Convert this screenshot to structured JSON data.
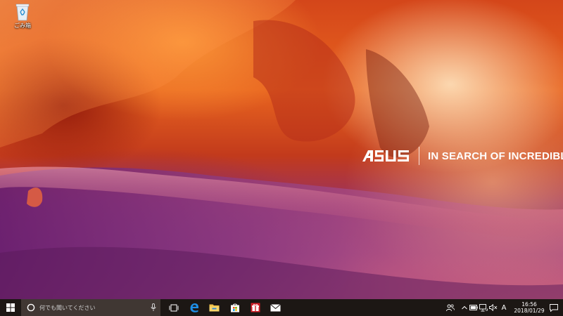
{
  "desktop": {
    "recycle_bin_label": "ごみ箱",
    "brand": "ASUS",
    "slogan": "IN SEARCH OF INCREDIBLE"
  },
  "taskbar": {
    "search_placeholder": "何でも聞いてください",
    "pinned": [
      "task-view-icon",
      "edge-icon",
      "file-explorer-icon",
      "store-icon",
      "gift-icon",
      "mail-icon"
    ],
    "ime_mode": "A",
    "clock_time": "16:56",
    "clock_date": "2018/01/29"
  },
  "colors": {
    "taskbar": "#1c1714",
    "search_box": "#403733",
    "edge_blue": "#1e8fe6",
    "windows_logo": "#ffffff"
  }
}
